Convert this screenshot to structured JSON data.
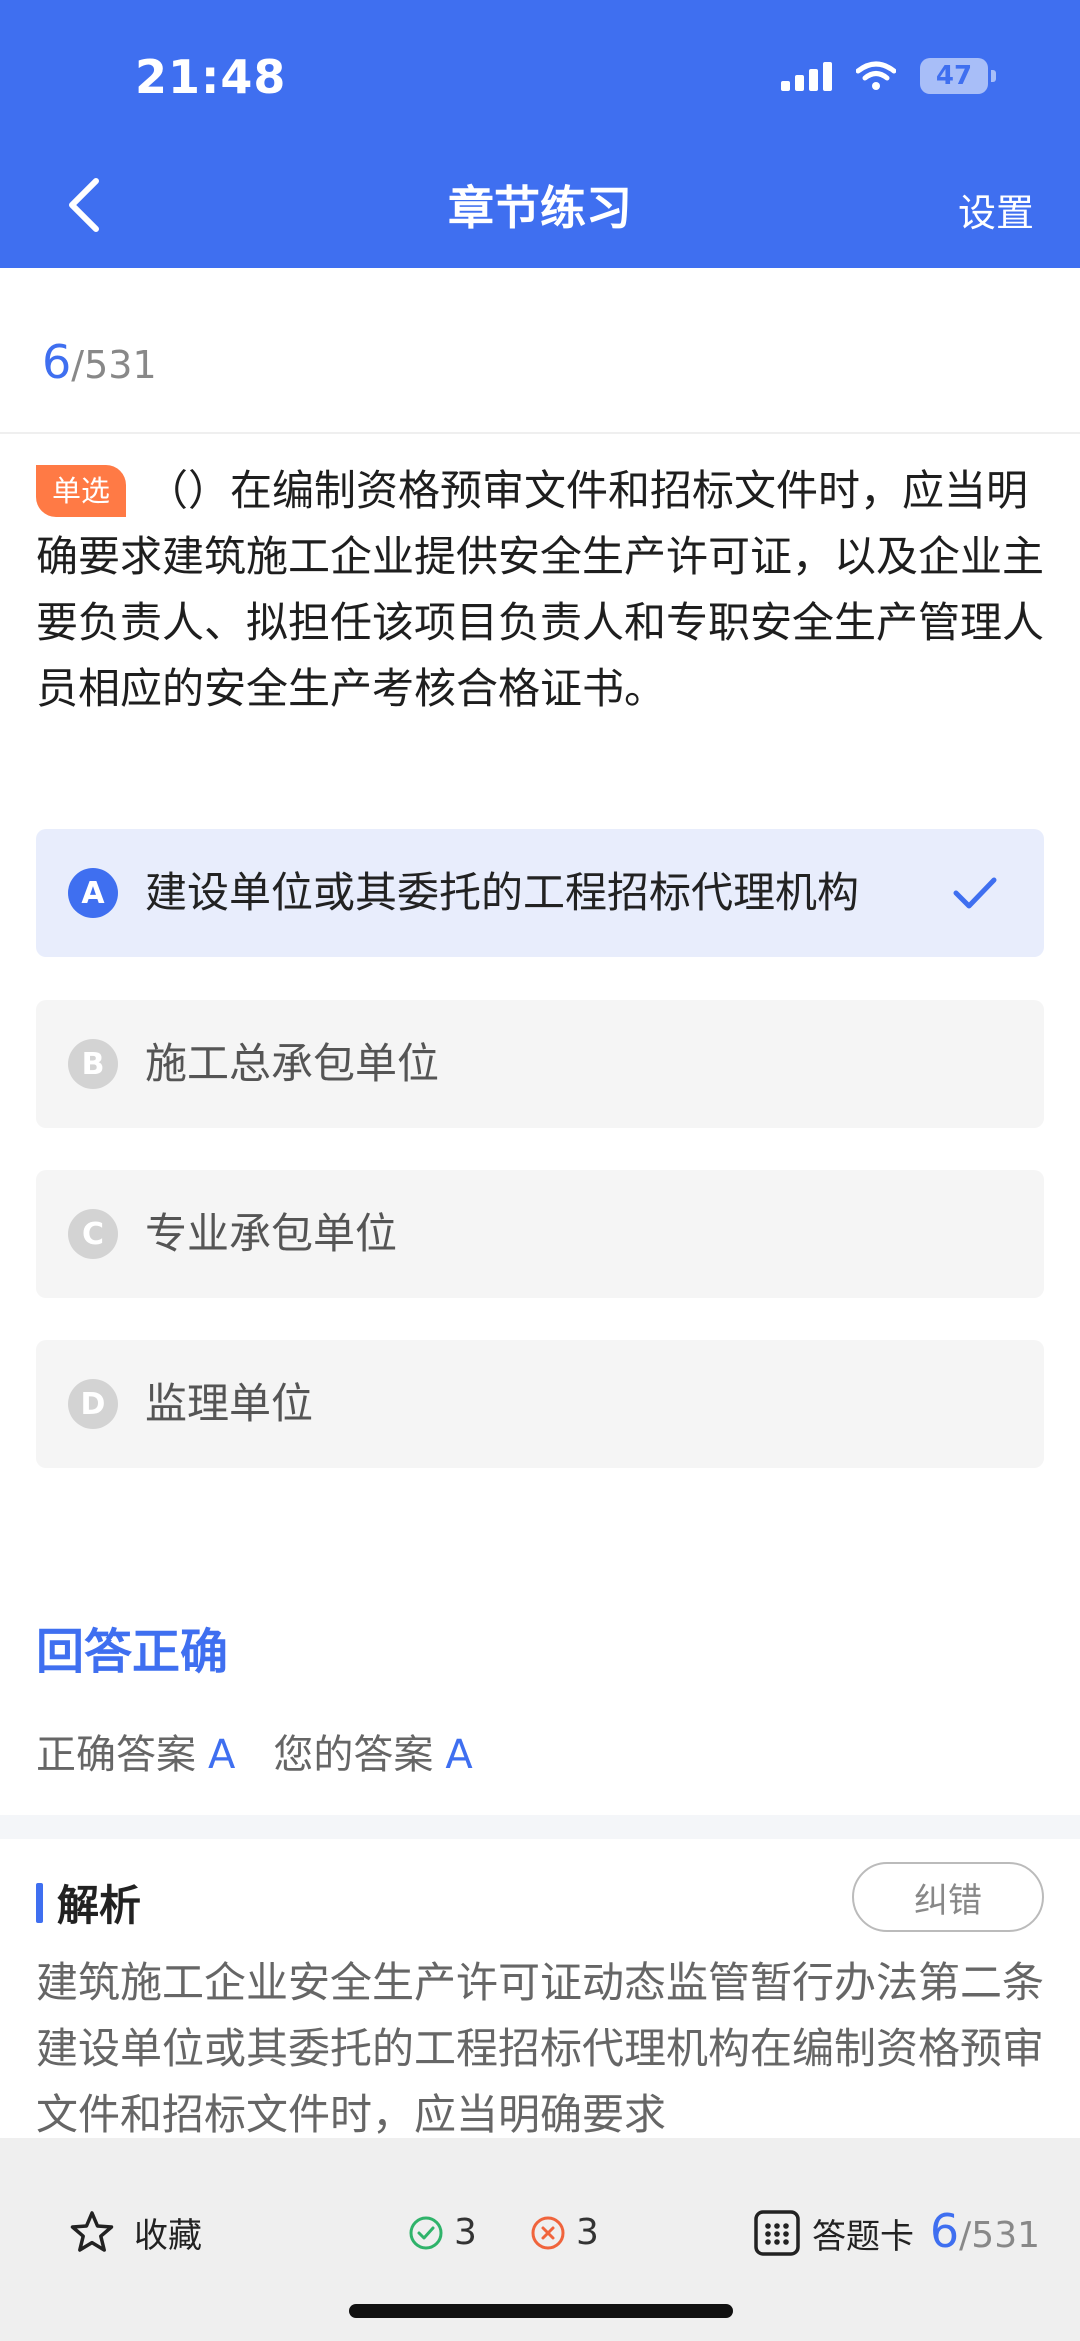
{
  "status_bar": {
    "time": "21:48",
    "battery": "47"
  },
  "header": {
    "title": "章节练习",
    "settings_label": "设置"
  },
  "progress": {
    "current": "6",
    "total": "/531"
  },
  "question": {
    "type": "单选",
    "text": "（）在编制资格预审文件和招标文件时，应当明确要求建筑施工企业提供安全生产许可证，以及企业主要负责人、拟担任该项目负责人和专职安全生产管理人员相应的安全生产考核合格证书。"
  },
  "options": [
    {
      "letter": "A",
      "text": "建设单位或其委托的工程招标代理机构",
      "selected": true
    },
    {
      "letter": "B",
      "text": "施工总承包单位",
      "selected": false
    },
    {
      "letter": "C",
      "text": "专业承包单位",
      "selected": false
    },
    {
      "letter": "D",
      "text": "监理单位",
      "selected": false
    }
  ],
  "result": {
    "title": "回答正确",
    "correct_label": "正确答案",
    "correct_value": "A",
    "yours_label": "您的答案",
    "yours_value": "A"
  },
  "analysis": {
    "title": "解析",
    "report_label": "纠错",
    "text": "建筑施工企业安全生产许可证动态监管暂行办法第二条建设单位或其委托的工程招标代理机构在编制资格预审文件和招标文件时，应当明确要求"
  },
  "bottom_bar": {
    "favorite_label": "收藏",
    "correct_count": "3",
    "wrong_count": "3",
    "card_label": "答题卡",
    "current": "6",
    "total": "/531"
  },
  "colors": {
    "primary": "#3f6ff0",
    "question_type_badge": "#ff7a45",
    "correct_icon": "#2fb36a",
    "wrong_icon": "#f0643c"
  },
  "icons": {
    "back": "chevron-left-icon",
    "check": "check-icon",
    "favorite": "star-outline-icon",
    "correct": "check-circle-icon",
    "wrong": "x-circle-icon",
    "answer_card": "grid-icon"
  }
}
